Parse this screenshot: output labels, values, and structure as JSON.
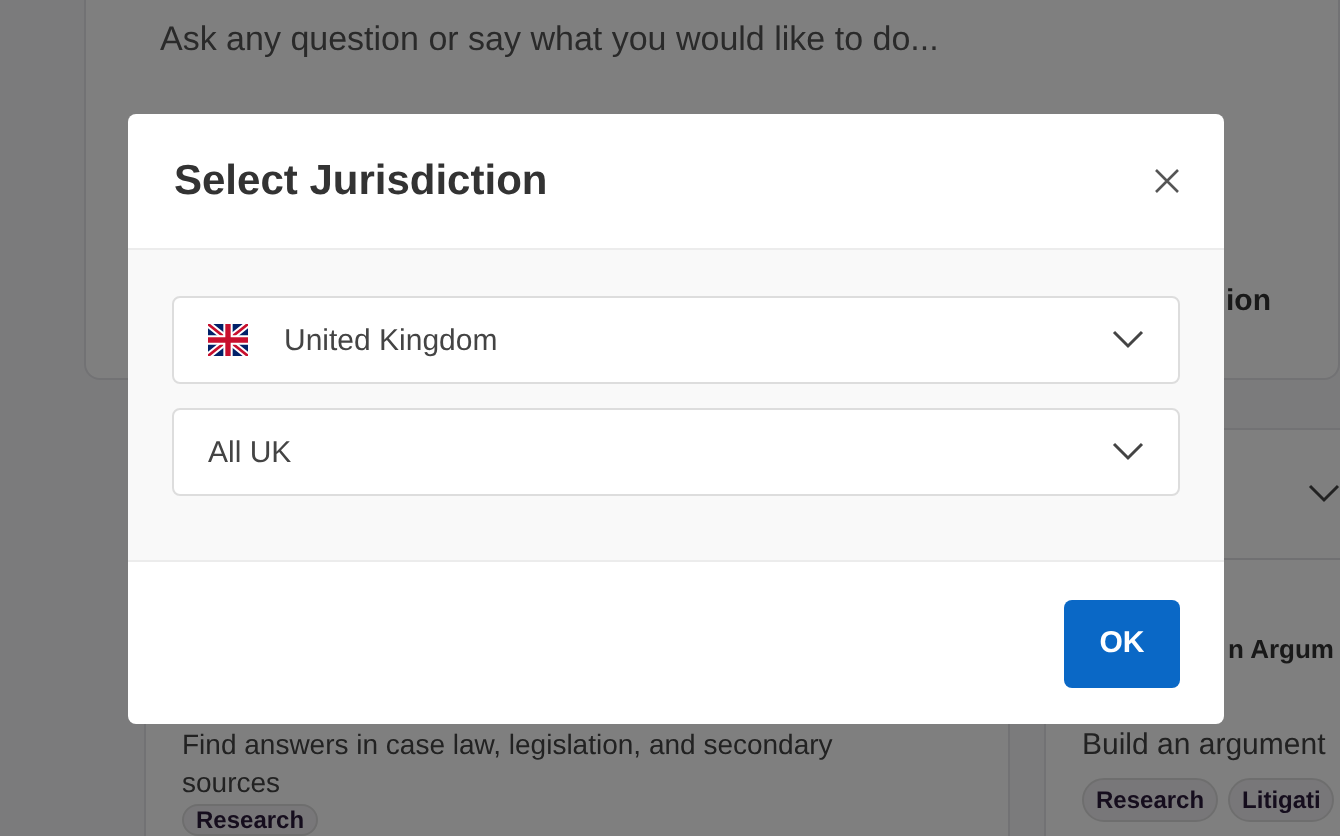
{
  "prompt_card": {
    "placeholder": "Ask any question or say what you would like to do...",
    "side_label": "ion"
  },
  "left_card": {
    "description": "Find answers in case law, legislation, and secondary sources",
    "tags": [
      "Research"
    ]
  },
  "right_card": {
    "title": "n Argum",
    "description": "Build an argument",
    "tags": [
      "Research",
      "Litigati"
    ]
  },
  "dialog": {
    "title": "Select Jurisdiction",
    "selects": [
      {
        "kind": "country",
        "value": "United Kingdom"
      },
      {
        "kind": "region",
        "value": "All UK"
      }
    ],
    "ok_button": "OK"
  }
}
